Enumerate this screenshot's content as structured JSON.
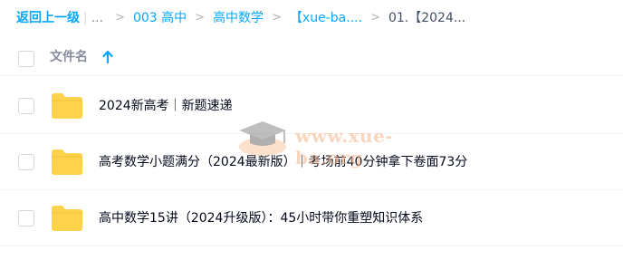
{
  "breadcrumb": {
    "back": "返回上一级",
    "ellipsis": "...",
    "items": [
      "003 高中",
      "高中数学",
      "【xue-ba...."
    ],
    "current": "01.【2024..."
  },
  "table": {
    "column_name": "文件名",
    "sort": "ascending"
  },
  "files": [
    {
      "name": "2024新高考｜新题速递",
      "type": "folder"
    },
    {
      "name": "高考数学小题满分（2024最新版）｜考场前40分钟拿下卷面73分",
      "type": "folder"
    },
    {
      "name": "高中数学15讲（2024升级版）：45小时带你重塑知识体系",
      "type": "folder"
    }
  ],
  "watermark": {
    "text": "www.xue-ba.org"
  },
  "colors": {
    "accent": "#06a7ff",
    "folder": "#ffd24c",
    "text": "#03081a",
    "muted": "#878c9c",
    "divider": "#f1f2f4"
  }
}
